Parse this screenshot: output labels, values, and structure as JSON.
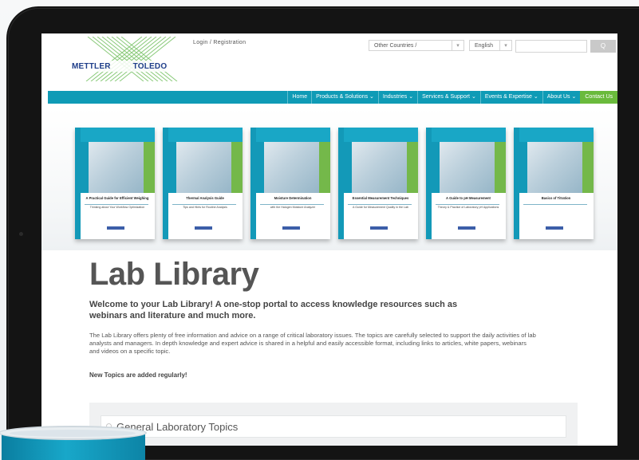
{
  "header": {
    "logo_left": "METTLER",
    "logo_right": "TOLEDO",
    "login": "Login / Registration",
    "country_select": "Other Countries /",
    "language_select": "English",
    "search_placeholder": "",
    "search_button": "Q"
  },
  "nav": {
    "items": [
      {
        "label": "Home"
      },
      {
        "label": "Products & Solutions ⌄"
      },
      {
        "label": "Industries ⌄"
      },
      {
        "label": "Services & Support ⌄"
      },
      {
        "label": "Events & Expertise ⌄"
      },
      {
        "label": "About Us ⌄"
      }
    ],
    "contact": "Contact Us"
  },
  "banner": {
    "books": [
      {
        "title": "A Practical Guide for Efficient Weighing",
        "subtitle": "Thinking about Your Workflow Optimization"
      },
      {
        "title": "Thermal Analysis Guide",
        "subtitle": "Tips and Hints for Routine Analysis"
      },
      {
        "title": "Moisture Determination",
        "subtitle": "with the Halogen Moisture Analyzer"
      },
      {
        "title": "Essential Measurement Techniques",
        "subtitle": "A Guide for Measurement Quality in the Lab"
      },
      {
        "title": "A Guide to pH Measurement",
        "subtitle": "Theory & Practice of Laboratory pH Applications"
      },
      {
        "title": "Basics of Titration",
        "subtitle": ""
      }
    ]
  },
  "main": {
    "title": "Lab Library",
    "intro": "Welcome to your Lab Library! A one-stop portal to access knowledge resources such as webinars and literature and much more.",
    "paragraph": "The Lab Library offers plenty of free information and advice on a range of critical laboratory issues. The topics are carefully selected to support the daily activities of lab analysts and managers. In depth knowledge and expert advice is shared in a helpful and easily accessible format, including links to articles, white papers, webinars and videos on a specific topic.",
    "new_topics": "New Topics are added regularly!",
    "accordion_item": "General Laboratory Topics"
  },
  "colors": {
    "nav": "#0f9bb6",
    "contact": "#6aba3c",
    "brand_blue": "#1f3e8a"
  }
}
